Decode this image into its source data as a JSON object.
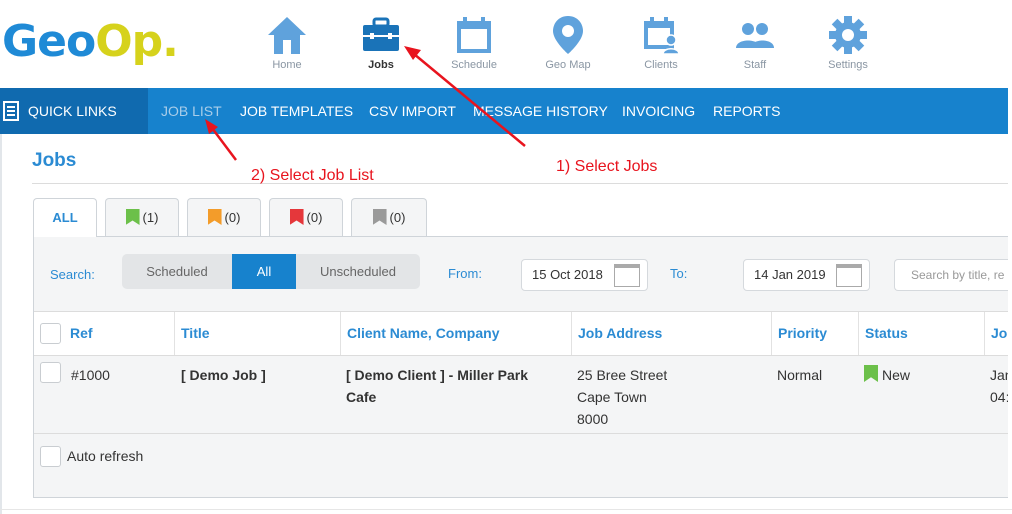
{
  "logo": {
    "part1": "Geo",
    "part2": "Op."
  },
  "nav": [
    {
      "label": "Home",
      "icon": "home-icon"
    },
    {
      "label": "Jobs",
      "icon": "briefcase-icon",
      "active": true
    },
    {
      "label": "Schedule",
      "icon": "calendar-icon"
    },
    {
      "label": "Geo Map",
      "icon": "map-pin-icon"
    },
    {
      "label": "Clients",
      "icon": "client-calendar-icon"
    },
    {
      "label": "Staff",
      "icon": "users-icon"
    },
    {
      "label": "Settings",
      "icon": "gear-icon"
    }
  ],
  "menubar": {
    "quick_links": "QUICK LINKS",
    "items": [
      "JOB LIST",
      "JOB TEMPLATES",
      "CSV IMPORT",
      "MESSAGE HISTORY",
      "INVOICING",
      "REPORTS"
    ]
  },
  "page": {
    "title": "Jobs"
  },
  "annotations": {
    "step1": "1) Select Jobs",
    "step2": "2) Select Job List"
  },
  "tabs": [
    {
      "label": "ALL"
    },
    {
      "label": "(1)",
      "flag_color": "#6cc04a"
    },
    {
      "label": "(0)",
      "flag_color": "#f39c2a"
    },
    {
      "label": "(0)",
      "flag_color": "#e5373b"
    },
    {
      "label": "(0)",
      "flag_color": "#9a9a9a"
    }
  ],
  "search": {
    "label": "Search:",
    "segments": [
      "Scheduled",
      "All",
      "Unscheduled"
    ],
    "active_segment": "All",
    "from_label": "From:",
    "from_date": "15 Oct 2018",
    "to_label": "To:",
    "to_date": "14 Jan 2019",
    "placeholder": "Search by title, re"
  },
  "table": {
    "headers": [
      "Ref",
      "Title",
      "Client Name, Company",
      "Job Address",
      "Priority",
      "Status",
      "Jo"
    ],
    "rows": [
      {
        "ref": "#1000",
        "title": "[ Demo Job ]",
        "client_line1": "[ Demo Client ] - Miller Park",
        "client_line2": "Cafe",
        "address_line1": "25 Bree Street",
        "address_line2": "Cape Town",
        "address_line3": "8000",
        "priority": "Normal",
        "status": "New",
        "job_line1": "Jan",
        "job_line2": "04:"
      }
    ]
  },
  "auto_refresh": "Auto refresh",
  "colors": {
    "primary": "#1782cd",
    "dark_primary": "#106aaf",
    "accent_text": "#2b8bd3",
    "annotation": "#e8141e",
    "logo_yellow": "#d6d21c"
  }
}
